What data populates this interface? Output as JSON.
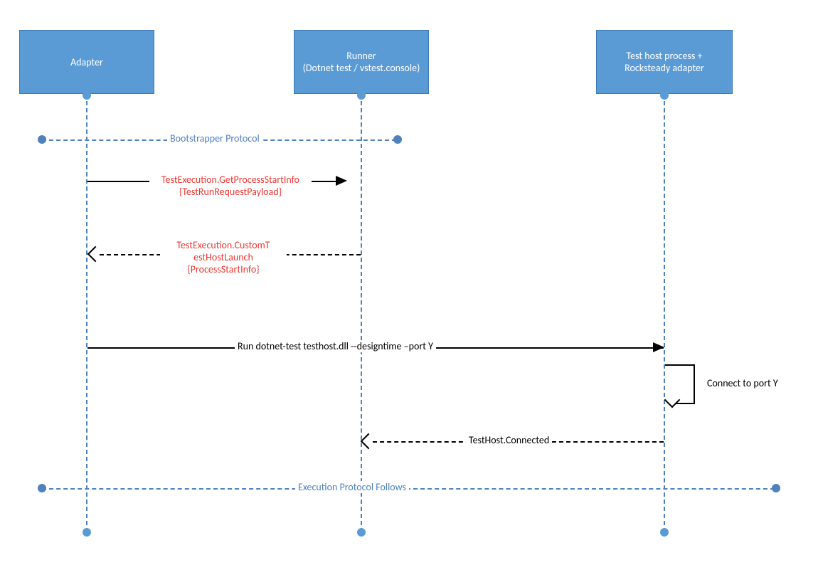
{
  "participants": [
    {
      "id": "adapter",
      "label": "Adapter"
    },
    {
      "id": "runner",
      "label": "Runner\n(Dotnet test / vstest.console)"
    },
    {
      "id": "testhost",
      "label": "Test host process + Rocksteady adapter"
    }
  ],
  "dividers": [
    {
      "id": "bootstrapper",
      "label": "Bootstrapper Protocol"
    },
    {
      "id": "execution",
      "label": "Execution Protocol Follows"
    }
  ],
  "messages": [
    {
      "id": "get_process_start_info",
      "from": "adapter",
      "to": "runner",
      "style": "solid",
      "color": "red",
      "line1": "TestExecution.GetProcessStartInfo",
      "line2": "{TestRunRequestPayload}"
    },
    {
      "id": "custom_testhost_launch",
      "from": "runner",
      "to": "adapter",
      "style": "dashed",
      "color": "red",
      "line1": "TestExecution.CustomT",
      "line2": "estHostLaunch",
      "line3": "{ProcessStartInfo}"
    },
    {
      "id": "run_dotnet_test",
      "from": "adapter",
      "to": "testhost",
      "style": "solid",
      "color": "black",
      "label": "Run dotnet-test testhost.dll --designtime –port Y"
    },
    {
      "id": "connect_port_y",
      "from": "testhost",
      "to": "testhost",
      "style": "solid",
      "color": "black",
      "label": "Connect to port Y"
    },
    {
      "id": "testhost_connected",
      "from": "testhost",
      "to": "runner",
      "style": "dashed",
      "color": "black",
      "label": "TestHost.Connected"
    }
  ],
  "colors": {
    "participant_fill": "#5b9bd5",
    "participant_border": "#3b77b5",
    "lifeline": "#4f81bd",
    "msg_highlight": "#ed3833"
  }
}
